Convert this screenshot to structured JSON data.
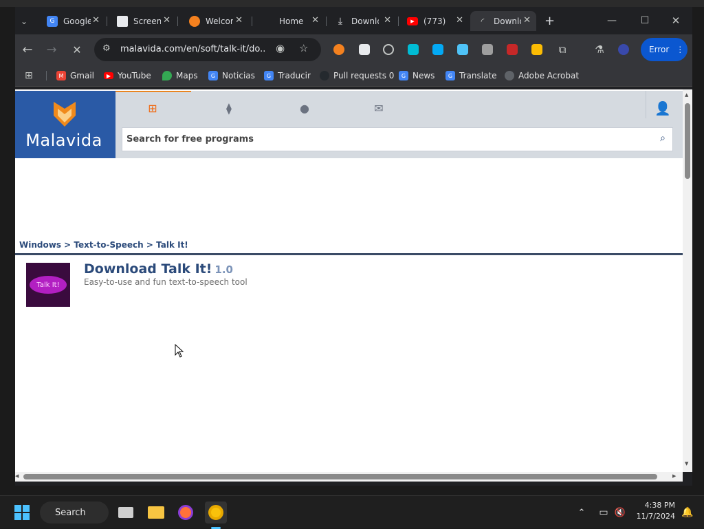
{
  "browser": {
    "tabs": [
      {
        "title": "Google",
        "favicon": "google-translate-icon",
        "color": "#4285f4"
      },
      {
        "title": "Screenshot",
        "favicon": "document-icon",
        "color": "#e8eaed"
      },
      {
        "title": "Welcome",
        "favicon": "app-icon",
        "color": "#f4811f"
      },
      {
        "title": "Home",
        "favicon": "home-icon",
        "color": "#202124"
      },
      {
        "title": "Downloads",
        "favicon": "download-icon",
        "color": "#e8eaed"
      },
      {
        "title": "(773)",
        "favicon": "youtube-icon",
        "color": "#ff0000"
      },
      {
        "title": "Download",
        "favicon": "loading-icon",
        "color": "#35363a"
      }
    ],
    "new_tab_label": "+",
    "url": "malavida.com/en/soft/talk-it/do...",
    "error_button": "Error",
    "bookmarks": [
      {
        "label": "Gmail",
        "icon": "gmail-icon",
        "color": "#ea4335"
      },
      {
        "label": "YouTube",
        "icon": "youtube-icon",
        "color": "#ff0000"
      },
      {
        "label": "Maps",
        "icon": "maps-icon",
        "color": "#34a853"
      },
      {
        "label": "Noticias",
        "icon": "news-icon",
        "color": "#4285f4"
      },
      {
        "label": "Traducir",
        "icon": "translate-icon",
        "color": "#4285f4"
      },
      {
        "label": "Pull requests 0",
        "icon": "github-icon",
        "color": "#24292e"
      },
      {
        "label": "News",
        "icon": "news-icon",
        "color": "#4285f4"
      },
      {
        "label": "Translate",
        "icon": "translate-icon",
        "color": "#4285f4"
      },
      {
        "label": "Adobe Acrobat",
        "icon": "globe-icon",
        "color": "#5f6368"
      }
    ]
  },
  "page": {
    "logo": "Malavida",
    "search_placeholder": "Search for free programs",
    "breadcrumb": "Windows > Text-to-Speech > Talk It!",
    "app": {
      "title": "Download Talk It!",
      "version": "1.0",
      "subtitle": "Easy-to-use and fun text-to-speech tool",
      "icon_text": "Talk It!"
    },
    "colors": {
      "brand": "#2a5aa6",
      "accent": "#e98521",
      "title": "#2b4a7a"
    }
  },
  "taskbar": {
    "search_label": "Search",
    "time": "4:38 PM",
    "date": "11/7/2024"
  }
}
